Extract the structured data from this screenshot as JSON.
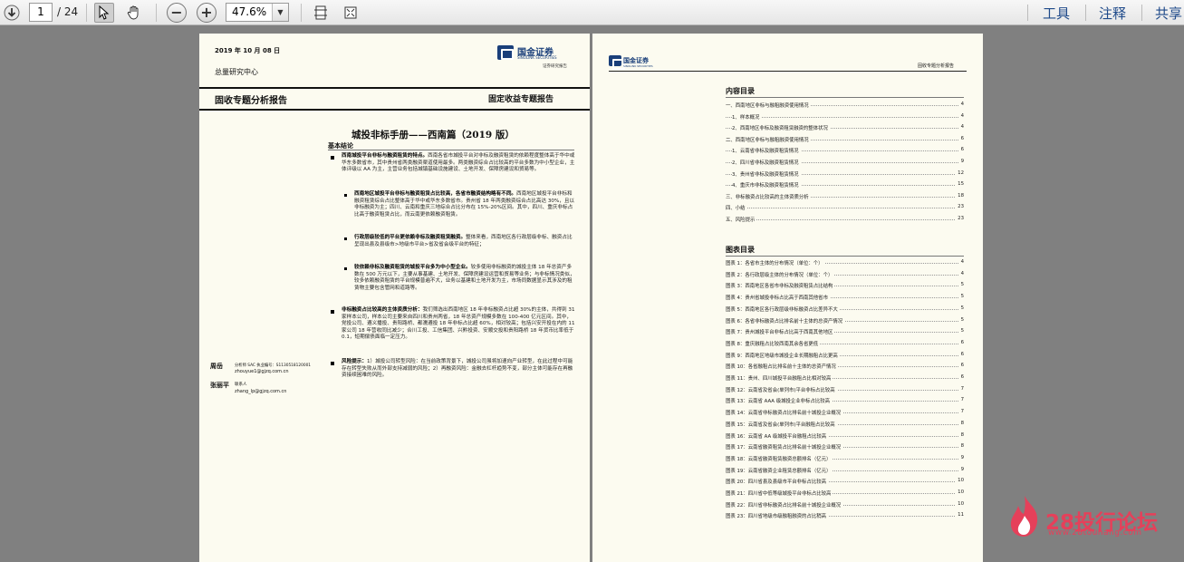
{
  "toolbar": {
    "page_current": "1",
    "page_total": "/ 24",
    "zoom": "47.6%",
    "tools_label": "工具",
    "comment_label": "注释",
    "share_label": "共享"
  },
  "left_page": {
    "date": "2019 年 10 月 08 日",
    "brand_name": "国金证券",
    "brand_en": "SINOLINK SECURITIES",
    "brand_sub": "证券研究报告",
    "dept": "总量研究中心",
    "header_left": "固收专题分析报告",
    "header_right": "固定收益专题报告",
    "title": "城投非标手册——西南篇（2019 版）",
    "section": "基本结论",
    "p1_bold": "西南城投平台非标与融资租赁的特点。",
    "p1": "西南各省市城投平台对非标及融资租赁的依赖程度整体高于华中或华东多数省市，其中贵州省两类融资渠道使用最多。两类融资综合占比较高的平台多数为中小型企业，主体评级以 AA 为主，主营业务包括城镇基础设施建设、土地开发、保障房建设和贸易等。",
    "p2_bold": "西南地区城投平台非标与融资租赁占比较高，各省市融资结构略有不同。",
    "p2": "西南地区城投平台非标和融资租赁综合占比整体高于华中或华东多数省市。贵州省 18 年两类融资综合占比高达 30%，且以非标融资为主；四川、云南和重庆三地综合占比分布在 15%-20%区间。其中，四川、重庆非标占比高于融资租赁占比，而云南更依赖融资租赁。",
    "p3_bold": "行政层级较低的平台更依赖非标及融资租赁融资。",
    "p3": "整体来看，西南地区各行政层级非标、融资占比呈现出县及县级市>地级市平台>省及省会级平台的特征；",
    "p4_bold": "较依赖非标及融资租赁的城投平台多为中小型企业。",
    "p4": "较多使用非标融资的城投主体 18 年总资产多数在 500 万元以下，主要从事基建、土地开发、保障房建设运营和贸易等业务；与非标情况类似，较多依赖融资租赁的平台规模普遍不大，业务以基建和土地开发为主，市场同数据显示其涉及的租赁物主要包含管网和道路等。",
    "p5_bold": "非标融资占比较高的主体资质分析：",
    "p5": "我们筛选出西南地区 18 年非标融资占比超 30%的主体，共得到 31 家样本公司，样本公司主要来自四川和贵州两省，18 年总资产规模多数在 100-400 亿元区间。其中，党投公司、遵义播投、贵阳路桥、都濡遵投 18 年非标占比超 60%，相对较高；包括兴安开投在内的 11 家公司 18 年营收同比减少；合川工投、工信集团、兴黔投资、安顺交投和贵阳路桥 18 年货币比率低于 0.1，短期偿债面临一定压力。",
    "p6_bold": "风险提示：",
    "p6": "1）城投公司转型风险：在当前政策背景下，城投公司虽将加速向产业转型，在此过程中可能存在转型失败从而外部支持减弱的风险；2）再融资风险：金融去杠杆趋势不变，部分主体可能存在再融资接续困难的风险。",
    "analyst1_name": "周岳",
    "analyst1_cert": "分析师 SAC 执业编号：S1130518120001",
    "analyst1_email": "zhouyue1@gjzq.com.cn",
    "analyst2_name": "张丽平",
    "analyst2_role": "联系人",
    "analyst2_email": "zhang_lp@gjzq.com.cn"
  },
  "right_page": {
    "brand_name": "国金证券",
    "brand_en": "SINOLINK SECURITIES",
    "header_right": "固收专题分析报告",
    "toc_title": "内容目录",
    "toc": [
      {
        "label": "一、西南地区非标与融租融资使用情况",
        "page": "4"
      },
      {
        "label": "1、样本概况",
        "page": "4"
      },
      {
        "label": "2、西南地区非标及融资租赁融资的整体状况",
        "page": "4"
      },
      {
        "label": "二、西南地区非标与融租融资使用情况",
        "page": "6"
      },
      {
        "label": "1、云南省非标及融资租赁情况",
        "page": "6"
      },
      {
        "label": "2、四川省非标及融资租赁情况",
        "page": "9"
      },
      {
        "label": "3、贵州省非标及融资租赁情况",
        "page": "12"
      },
      {
        "label": "4、重庆市非标及融资租赁情况",
        "page": "15"
      },
      {
        "label": "三、非标融资占比较高的主体资质分析",
        "page": "18"
      },
      {
        "label": "四、小结",
        "page": "23"
      },
      {
        "label": "五、风险提示",
        "page": "23"
      }
    ],
    "fig_title": "图表目录",
    "figs": [
      {
        "label": "图表 1：各省市主体的分布情况（单位：个）",
        "page": "4"
      },
      {
        "label": "图表 2：各行政层级主体的分布情况（单位：个）",
        "page": "4"
      },
      {
        "label": "图表 3：西南地区各省市非标及融资租赁占比结构",
        "page": "5"
      },
      {
        "label": "图表 4：贵州省城投非标占比高于西南其他省市",
        "page": "5"
      },
      {
        "label": "图表 5：西南地区各行政层级非标融资占比差异不大",
        "page": "5"
      },
      {
        "label": "图表 6：各省非标融资占比排名前十主体的总资产情况",
        "page": "5"
      },
      {
        "label": "图表 7：贵州城投平台非标占比高于西南其他地区",
        "page": "5"
      },
      {
        "label": "图表 8：重庆融租占比较西南其余各省更低",
        "page": "6"
      },
      {
        "label": "图表 9：西南地区地级市城投企业长期融租占比更高",
        "page": "6"
      },
      {
        "label": "图表 10：各省融租占比排名前十主体的总资产情况",
        "page": "6"
      },
      {
        "label": "图表 11：贵州、四川城投平台融租占比相对较高",
        "page": "6"
      },
      {
        "label": "图表 12：云南省及省会(单列市)平台非标占比较高",
        "page": "7"
      },
      {
        "label": "图表 13：云南省 AAA 级城投企业非标占比较高",
        "page": "7"
      },
      {
        "label": "图表 14：云南省非标融资占比排名前十城投企业概况",
        "page": "7"
      },
      {
        "label": "图表 15：云南省及省会(单列市)平台融租占比较高",
        "page": "8"
      },
      {
        "label": "图表 16：云南省 AA 级城投平台融租占比较高",
        "page": "8"
      },
      {
        "label": "图表 17：云南省融资租赁占比排名前十城投企业概况",
        "page": "8"
      },
      {
        "label": "图表 18：云南省融资租赁融资总额排名（亿元）",
        "page": "9"
      },
      {
        "label": "图表 19：云南省融资企业租赁总额排名（亿元）",
        "page": "9"
      },
      {
        "label": "图表 20：四川省县及县级市平台非标占比较高",
        "page": "10"
      },
      {
        "label": "图表 21：四川省中低等级城投平台非标占比较高",
        "page": "10"
      },
      {
        "label": "图表 22：四川省非标融资占比排名前十城投企业概况",
        "page": "10"
      },
      {
        "label": "图表 23：四川省地级市级融租融资的占比稍高",
        "page": "11"
      }
    ]
  },
  "watermark": {
    "title": "28投行论坛",
    "url": "www.28touhang.com"
  }
}
